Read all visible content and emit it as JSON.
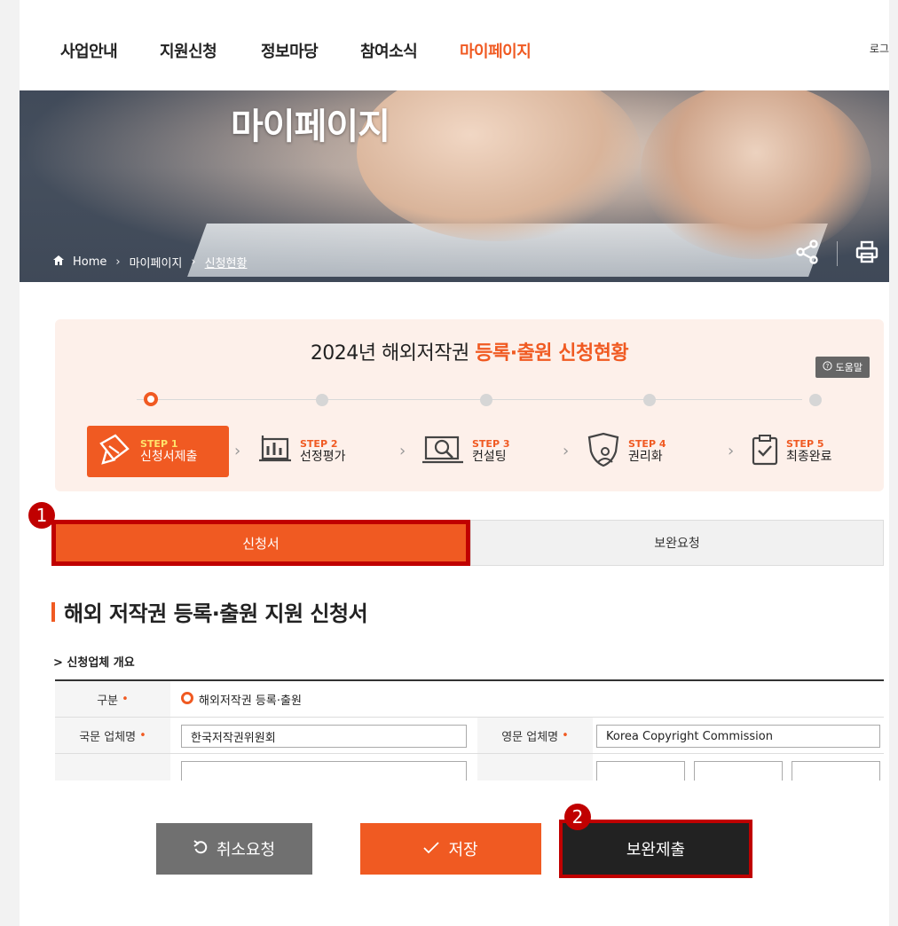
{
  "nav": {
    "items": [
      "사업안내",
      "지원신청",
      "정보마당",
      "참여소식",
      "마이페이지"
    ],
    "active_index": 4,
    "login": "로그"
  },
  "hero": {
    "title": "마이페이지",
    "breadcrumb": [
      "Home",
      "마이페이지",
      "신청현황"
    ],
    "share_icon": "share-icon",
    "print_icon": "print-icon"
  },
  "steps_panel": {
    "title_prefix": "2024년 해외저작권 ",
    "title_highlight": "등록·출원 신청현황",
    "help_label": "도움말",
    "steps": [
      {
        "top": "STEP 1",
        "label": "신청서제출",
        "icon": "document-pen-icon",
        "active": true
      },
      {
        "top": "STEP 2",
        "label": "선정평가",
        "icon": "chart-board-icon",
        "active": false
      },
      {
        "top": "STEP 3",
        "label": "컨설팅",
        "icon": "monitor-search-icon",
        "active": false
      },
      {
        "top": "STEP 4",
        "label": "권리화",
        "icon": "shield-user-icon",
        "active": false
      },
      {
        "top": "STEP 5",
        "label": "최종완료",
        "icon": "clipboard-check-icon",
        "active": false
      }
    ]
  },
  "tabs": {
    "items": [
      "신청서",
      "보완요청"
    ],
    "active_index": 0
  },
  "markers": {
    "first": "1",
    "second": "2"
  },
  "form": {
    "title": "해외 저작권 등록·출원 지원 신청서",
    "section_title": "> 신청업체 개요",
    "rows": {
      "type_label": "구분",
      "type_value": "해외저작권 등록·출원",
      "kor_name_label": "국문 업체명",
      "kor_name_value": "한국저작권위원회",
      "eng_name_label": "영문 업체명",
      "eng_name_value": "Korea Copyright Commission"
    }
  },
  "buttons": {
    "cancel": "취소요청",
    "save": "저장",
    "submit": "보완제출"
  },
  "colors": {
    "accent": "#f05a22",
    "highlight_box": "#c00000",
    "dark_button": "#222222",
    "gray_button": "#707070"
  }
}
